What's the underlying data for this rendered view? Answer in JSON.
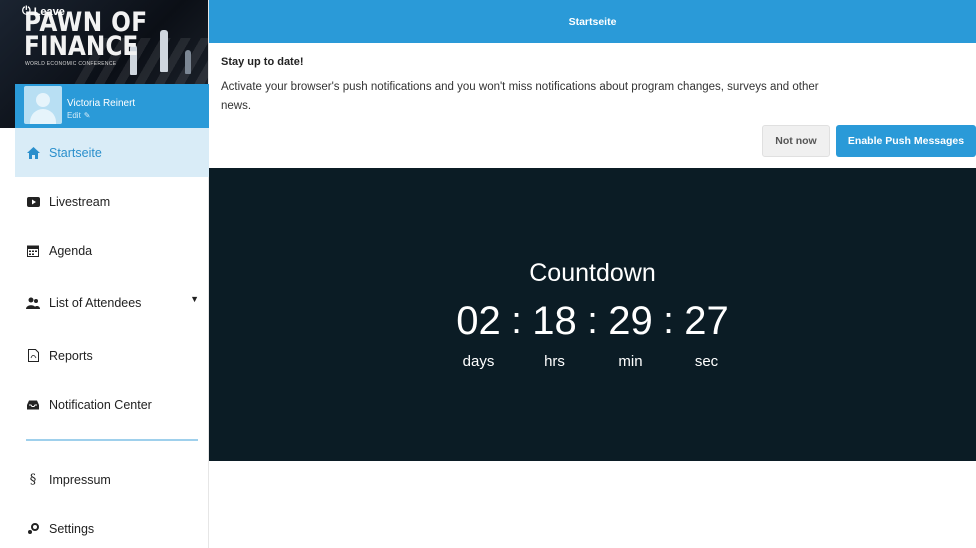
{
  "banner": {
    "leave_label": "Leave",
    "title_line1": "PAWN OF",
    "title_line2": "FINANCE",
    "subtitle": "WORLD ECONOMIC CONFERENCE"
  },
  "user": {
    "name": "Victoria Reinert",
    "edit_label": "Edit"
  },
  "sidebar": {
    "items": [
      {
        "label": "Startseite",
        "icon": "home-icon",
        "active": true
      },
      {
        "label": "Livestream",
        "icon": "play-icon"
      },
      {
        "label": "Agenda",
        "icon": "calendar-icon"
      },
      {
        "label": "List of Attendees",
        "icon": "attendees-icon",
        "has_dropdown": true
      },
      {
        "label": "Reports",
        "icon": "pdf-icon"
      },
      {
        "label": "Notification Center",
        "icon": "inbox-icon"
      }
    ],
    "bottom_items": [
      {
        "label": "Impressum",
        "icon": "section-icon"
      },
      {
        "label": "Settings",
        "icon": "settings-icon"
      }
    ]
  },
  "header": {
    "title": "Startseite"
  },
  "push_notice": {
    "title": "Stay up to date!",
    "text": "Activate your browser's push notifications and you won't miss notifications about program changes, surveys and other news.",
    "not_now_label": "Not now",
    "enable_label": "Enable Push Messages"
  },
  "countdown": {
    "title": "Countdown",
    "days": "02",
    "hrs": "18",
    "min": "29",
    "sec": "27",
    "separator": ":",
    "labels": {
      "days": "days",
      "hrs": "hrs",
      "min": "min",
      "sec": "sec"
    }
  },
  "colors": {
    "accent": "#2a9ad8",
    "active_bg": "#d9ecf7",
    "countdown_bg": "#0b1c25"
  }
}
